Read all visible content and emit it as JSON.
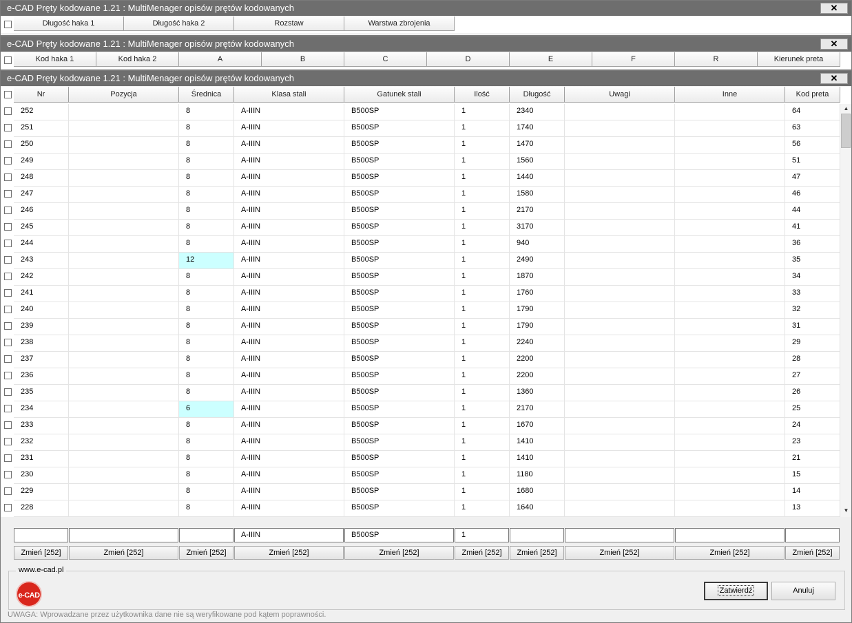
{
  "window1": {
    "title": "e-CAD Pręty kodowane 1.21 : MultiMenager opisów prętów kodowanych",
    "close": "✕",
    "headers": [
      "Długość haka 1",
      "Długość haka 2",
      "Rozstaw",
      "Warstwa zbrojenia"
    ]
  },
  "window2": {
    "title": "e-CAD Pręty kodowane 1.21 : MultiMenager opisów prętów kodowanych",
    "close": "✕",
    "headers": [
      "Kod haka 1",
      "Kod haka 2",
      "A",
      "B",
      "C",
      "D",
      "E",
      "F",
      "R",
      "Kierunek preta"
    ]
  },
  "window3": {
    "title": "e-CAD Pręty kodowane 1.21 : MultiMenager opisów prętów kodowanych",
    "close": "✕",
    "columns": [
      "Nr",
      "Pozycja",
      "Średnica",
      "Klasa stali",
      "Gatunek stali",
      "Ilość",
      "Długość",
      "Uwagi",
      "Inne",
      "Kod preta"
    ],
    "rows": [
      [
        "252",
        "",
        "8",
        "A-IIIN",
        "B500SP",
        "1",
        "2340",
        "",
        "",
        "64"
      ],
      [
        "251",
        "",
        "8",
        "A-IIIN",
        "B500SP",
        "1",
        "1740",
        "",
        "",
        "63"
      ],
      [
        "250",
        "",
        "8",
        "A-IIIN",
        "B500SP",
        "1",
        "1470",
        "",
        "",
        "56"
      ],
      [
        "249",
        "",
        "8",
        "A-IIIN",
        "B500SP",
        "1",
        "1560",
        "",
        "",
        "51"
      ],
      [
        "248",
        "",
        "8",
        "A-IIIN",
        "B500SP",
        "1",
        "1440",
        "",
        "",
        "47"
      ],
      [
        "247",
        "",
        "8",
        "A-IIIN",
        "B500SP",
        "1",
        "1580",
        "",
        "",
        "46"
      ],
      [
        "246",
        "",
        "8",
        "A-IIIN",
        "B500SP",
        "1",
        "2170",
        "",
        "",
        "44"
      ],
      [
        "245",
        "",
        "8",
        "A-IIIN",
        "B500SP",
        "1",
        "3170",
        "",
        "",
        "41"
      ],
      [
        "244",
        "",
        "8",
        "A-IIIN",
        "B500SP",
        "1",
        "940",
        "",
        "",
        "36"
      ],
      [
        "243",
        "",
        "12",
        "A-IIIN",
        "B500SP",
        "1",
        "2490",
        "",
        "",
        "35"
      ],
      [
        "242",
        "",
        "8",
        "A-IIIN",
        "B500SP",
        "1",
        "1870",
        "",
        "",
        "34"
      ],
      [
        "241",
        "",
        "8",
        "A-IIIN",
        "B500SP",
        "1",
        "1760",
        "",
        "",
        "33"
      ],
      [
        "240",
        "",
        "8",
        "A-IIIN",
        "B500SP",
        "1",
        "1790",
        "",
        "",
        "32"
      ],
      [
        "239",
        "",
        "8",
        "A-IIIN",
        "B500SP",
        "1",
        "1790",
        "",
        "",
        "31"
      ],
      [
        "238",
        "",
        "8",
        "A-IIIN",
        "B500SP",
        "1",
        "2240",
        "",
        "",
        "29"
      ],
      [
        "237",
        "",
        "8",
        "A-IIIN",
        "B500SP",
        "1",
        "2200",
        "",
        "",
        "28"
      ],
      [
        "236",
        "",
        "8",
        "A-IIIN",
        "B500SP",
        "1",
        "2200",
        "",
        "",
        "27"
      ],
      [
        "235",
        "",
        "8",
        "A-IIIN",
        "B500SP",
        "1",
        "1360",
        "",
        "",
        "26"
      ],
      [
        "234",
        "",
        "6",
        "A-IIIN",
        "B500SP",
        "1",
        "2170",
        "",
        "",
        "25"
      ],
      [
        "233",
        "",
        "8",
        "A-IIIN",
        "B500SP",
        "1",
        "1670",
        "",
        "",
        "24"
      ],
      [
        "232",
        "",
        "8",
        "A-IIIN",
        "B500SP",
        "1",
        "1410",
        "",
        "",
        "23"
      ],
      [
        "231",
        "",
        "8",
        "A-IIIN",
        "B500SP",
        "1",
        "1410",
        "",
        "",
        "21"
      ],
      [
        "230",
        "",
        "8",
        "A-IIIN",
        "B500SP",
        "1",
        "1180",
        "",
        "",
        "15"
      ],
      [
        "229",
        "",
        "8",
        "A-IIIN",
        "B500SP",
        "1",
        "1680",
        "",
        "",
        "14"
      ],
      [
        "228",
        "",
        "8",
        "A-IIIN",
        "B500SP",
        "1",
        "1640",
        "",
        "",
        "13"
      ]
    ],
    "highlighted_rows": [
      9,
      18
    ],
    "highlight_color": "#ccffff",
    "edit_values": [
      "",
      "",
      "",
      "A-IIIN",
      "B500SP",
      "1",
      "",
      "",
      "",
      ""
    ],
    "change_buttons": [
      "Zmień [252]",
      "Zmień [252]",
      "Zmień [252]",
      "Zmień [252]",
      "Zmień [252]",
      "Zmień [252]",
      "Zmień [252]",
      "Zmień [252]",
      "Zmień [252]",
      "Zmień [252]"
    ],
    "scroll": {
      "up": "▲",
      "down": "▼",
      "left": "◄",
      "right": "►"
    }
  },
  "footer": {
    "website": "www.e-cad.pl",
    "logo_text": "e-CAD",
    "confirm": "Zatwierdź",
    "cancel": "Anuluj",
    "warning": "UWAGA: Wprowadzane przez użytkownika dane nie są weryfikowane pod kątem poprawności."
  },
  "colors": {
    "titlebar": "#6e6e6e",
    "logo": "#d9261c"
  }
}
